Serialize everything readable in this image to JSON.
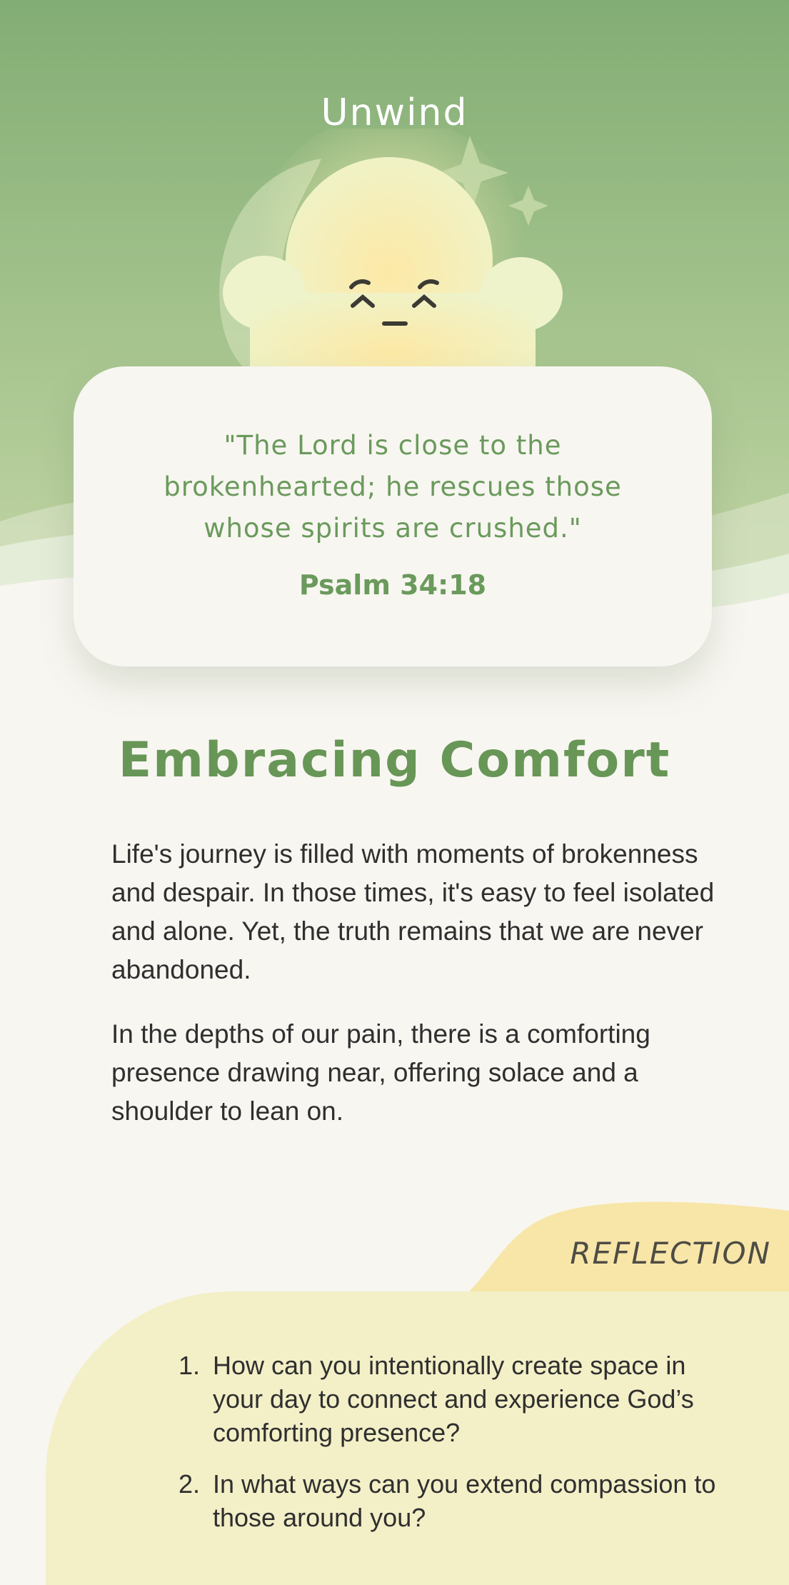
{
  "app": {
    "title": "Unwind"
  },
  "verse": {
    "text": "\"The Lord is close to the brokenhearted; he rescues those whose spirits are crushed.\"",
    "reference": "Psalm 34:18"
  },
  "devotional": {
    "title": "Embracing Comfort",
    "paragraphs": [
      "Life's journey is filled with moments of brokenness and despair. In those times, it's easy to feel isolated and alone. Yet, the truth remains that we are never abandoned.",
      "In the depths of our pain, there is a comforting presence drawing near, offering solace and a shoulder to lean on."
    ]
  },
  "reflection": {
    "label": "REFLECTION",
    "questions": [
      {
        "number": "1.",
        "text": "How can you intentionally create space in your day to connect and experience God’s comforting presence?"
      },
      {
        "number": "2.",
        "text": "In what ways can you extend compassion to those around you?"
      }
    ]
  },
  "colors": {
    "header_top": "#82ad74",
    "header_bottom": "#c3d6a6",
    "background": "#f8f6f1",
    "accent_green": "#679656",
    "reflection_panel": "#f3efc7",
    "reflection_tab": "#f8e6a8",
    "body_text": "#2f2f2f"
  },
  "icons": {
    "mascot": "sleepy-cloud-mascot",
    "moon": "crescent-moon-icon",
    "stars": "sparkle-star-icon"
  }
}
